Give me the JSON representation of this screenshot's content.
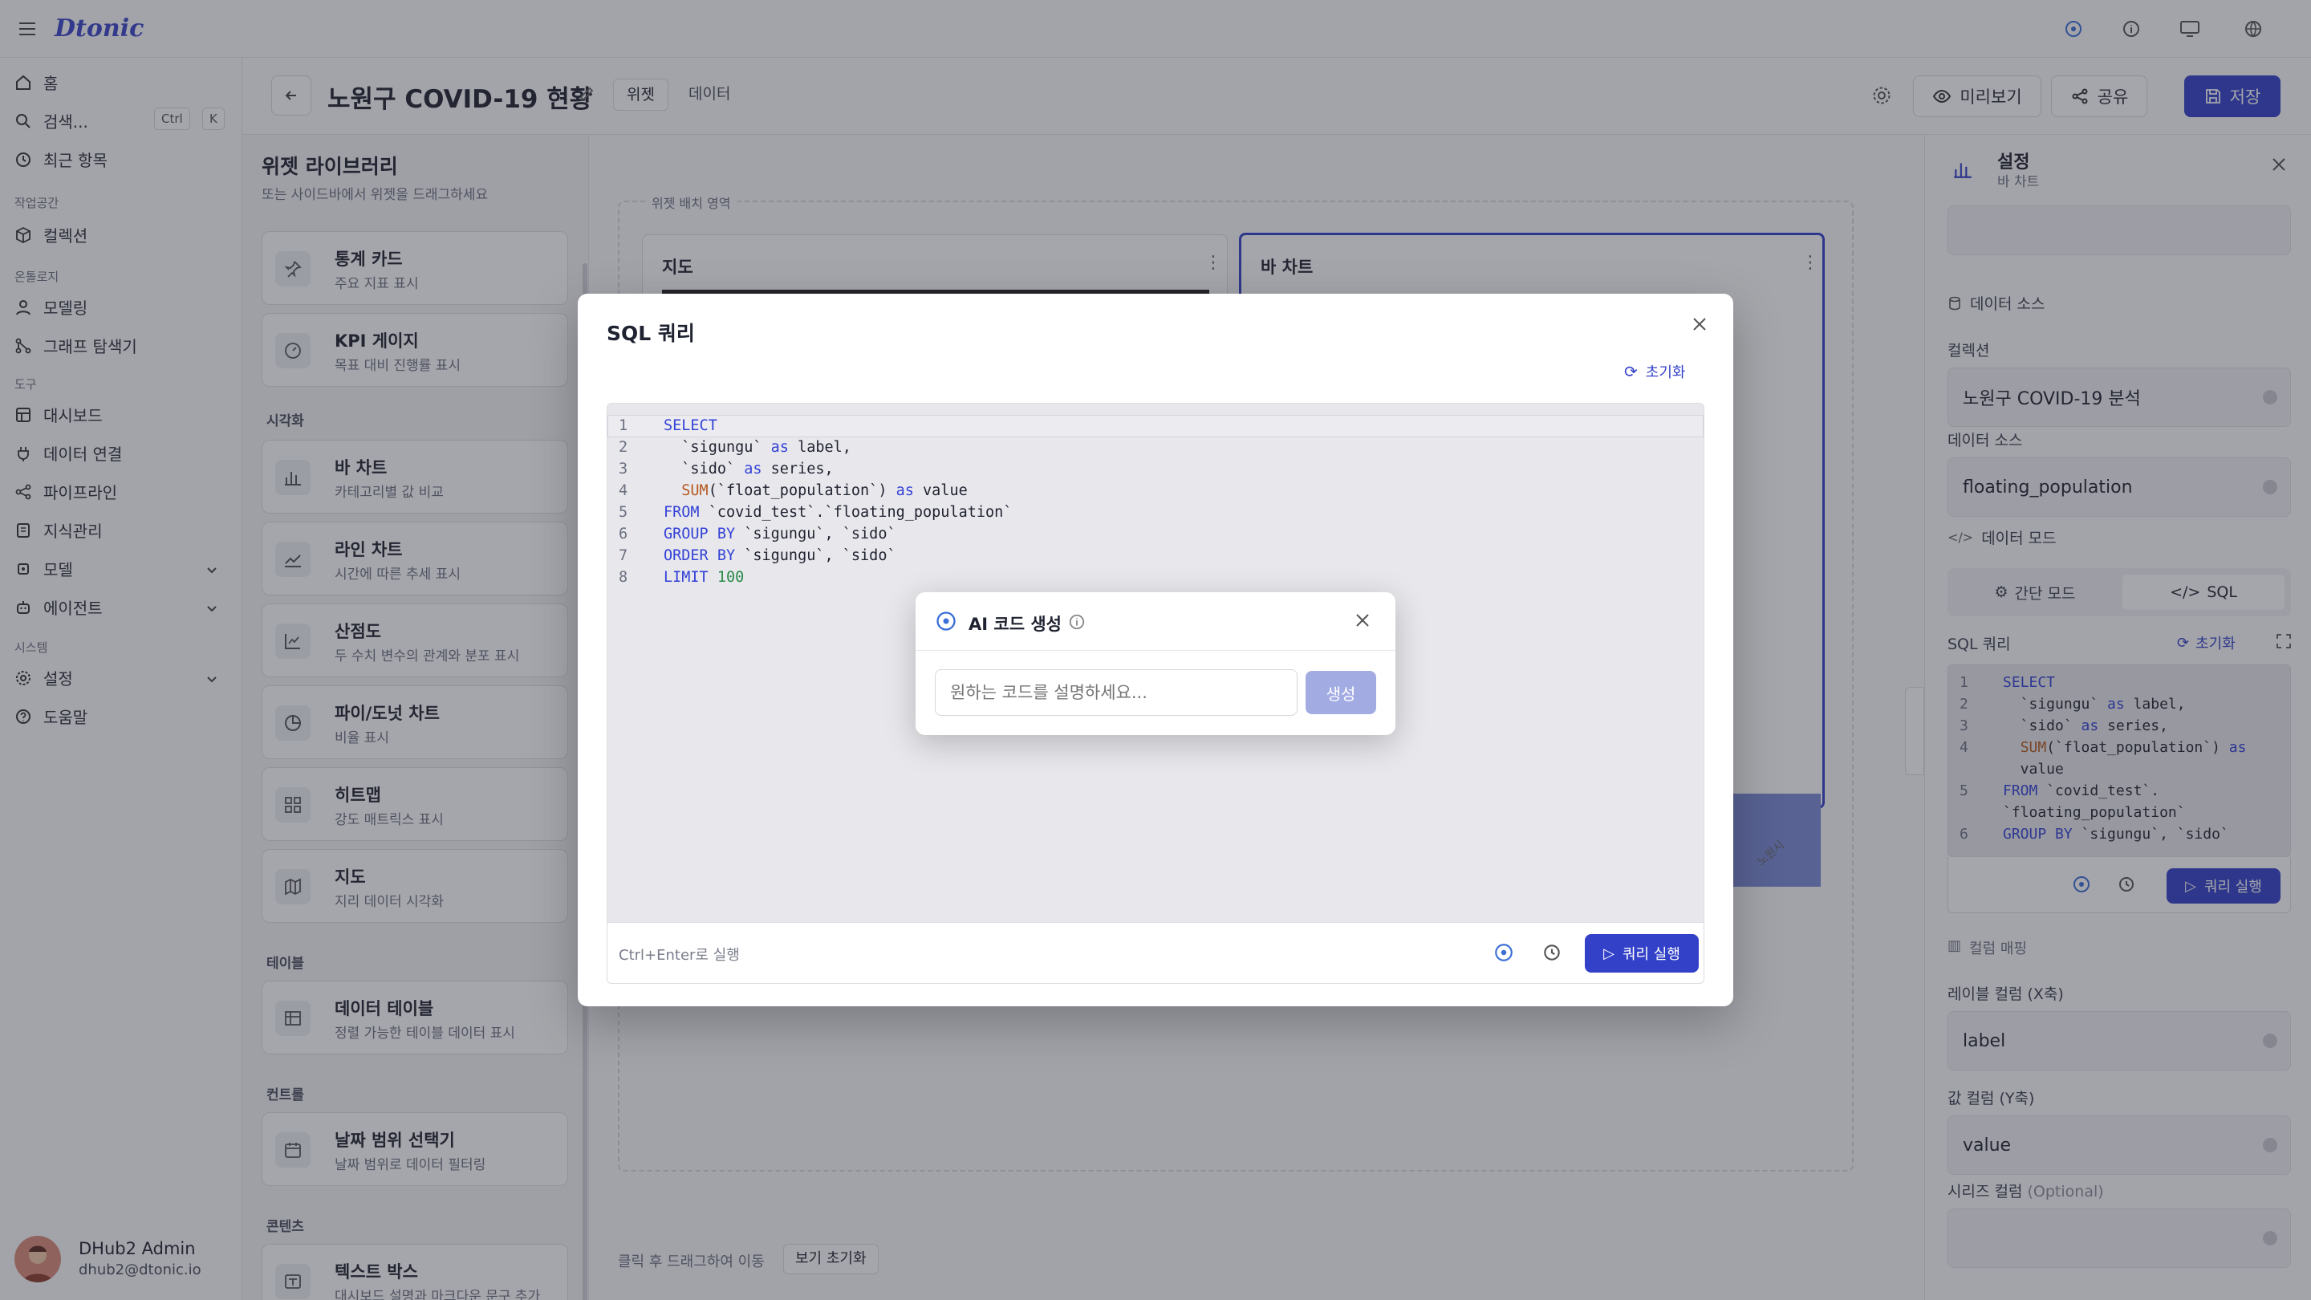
{
  "app": {
    "logo": "Dtonic"
  },
  "sidebar": {
    "items": [
      {
        "label": "홈"
      },
      {
        "label": "검색..."
      },
      {
        "label": "최근 항목"
      }
    ],
    "search_shortcut": [
      "Ctrl",
      "K"
    ],
    "sections": {
      "workspace": "작업공간",
      "ontology": "온톨로지",
      "tools": "도구",
      "system": "시스템"
    },
    "workspace_items": [
      {
        "label": "컬렉션"
      }
    ],
    "ontology_items": [
      {
        "label": "모델링"
      },
      {
        "label": "그래프 탐색기"
      }
    ],
    "tool_items": [
      {
        "label": "대시보드"
      },
      {
        "label": "데이터 연결"
      },
      {
        "label": "파이프라인"
      },
      {
        "label": "지식관리"
      },
      {
        "label": "모델"
      },
      {
        "label": "에이전트"
      }
    ],
    "system_items": [
      {
        "label": "설정"
      },
      {
        "label": "도움말"
      }
    ],
    "user": {
      "name": "DHub2 Admin",
      "email": "dhub2@dtonic.io"
    }
  },
  "header": {
    "title": "노원구 COVID-19 현황",
    "tabs": [
      {
        "label": "위젯"
      },
      {
        "label": "데이터"
      }
    ],
    "preview_label": "미리보기",
    "share_label": "공유",
    "save_label": "저장"
  },
  "library": {
    "title": "위젯 라이브러리",
    "subtitle": "또는 사이드바에서 위젯을 드래그하세요",
    "cards_top": [
      {
        "title": "통계 카드",
        "desc": "주요 지표 표시"
      },
      {
        "title": "KPI 게이지",
        "desc": "목표 대비 진행률 표시"
      }
    ],
    "sec_viz": "시각화",
    "viz": [
      {
        "title": "바 차트",
        "desc": "카테고리별 값 비교"
      },
      {
        "title": "라인 차트",
        "desc": "시간에 따른 추세 표시"
      },
      {
        "title": "산점도",
        "desc": "두 수치 변수의 관계와 분포 표시"
      },
      {
        "title": "파이/도넛 차트",
        "desc": "비율 표시"
      },
      {
        "title": "히트맵",
        "desc": "강도 매트릭스 표시"
      },
      {
        "title": "지도",
        "desc": "지리 데이터 시각화"
      }
    ],
    "sec_table": "테이블",
    "table": [
      {
        "title": "데이터 테이블",
        "desc": "정렬 가능한 테이블 데이터 표시"
      }
    ],
    "sec_control": "컨트롤",
    "control": [
      {
        "title": "날짜 범위 선택기",
        "desc": "날짜 범위로 데이터 필터링"
      }
    ],
    "sec_content": "콘텐츠",
    "content": [
      {
        "title": "텍스트 박스",
        "desc": "대시보드 설명과 마크다운 문구 추가"
      }
    ]
  },
  "canvas": {
    "area_label": "위젯 배치 영역",
    "widget_map": "지도",
    "widget_bar": "바 차트",
    "hint": "클릭 후 드래그하여 이동",
    "reset_view": "보기 초기화",
    "bar_tick": "노원시"
  },
  "right_panel": {
    "title": "설정",
    "subtitle": "바 차트",
    "datasource_heading": "데이터 소스",
    "collection_label": "컬렉션",
    "collection_value": "노원구 COVID-19 분석",
    "source_label": "데이터 소스",
    "source_value": "floating_population",
    "mode_heading": "데이터 모드",
    "mode_simple": "간단 모드",
    "mode_sql": "SQL",
    "sql_label": "SQL 쿼리",
    "reset": "초기화",
    "run": "쿼리 실행",
    "mini_code": [
      {
        "n": "1",
        "text": "SELECT"
      },
      {
        "n": "2",
        "text": "  `sigungu` as label,"
      },
      {
        "n": "3",
        "text": "  `sido` as series,"
      },
      {
        "n": "4",
        "text": "  SUM(`float_population`) as"
      },
      {
        "n": "",
        "text": "  value"
      },
      {
        "n": "5",
        "text": "FROM `covid_test`."
      },
      {
        "n": "",
        "text": "`floating_population`"
      },
      {
        "n": "6",
        "text": "GROUP BY `sigungu`, `sido`"
      }
    ],
    "column_mapping": "컬럼 매핑",
    "label_col": "레이블 컬럼 (X축)",
    "label_value": "label",
    "value_col": "값 컬럼 (Y축)",
    "value_value": "value",
    "series_col": "시리즈 컬럼",
    "series_optional": "(Optional)"
  },
  "modal": {
    "title": "SQL 쿼리",
    "reset": "초기화",
    "code": [
      {
        "n": "1",
        "text": "SELECT"
      },
      {
        "n": "2",
        "text": "  `sigungu` as label,"
      },
      {
        "n": "3",
        "text": "  `sido` as series,"
      },
      {
        "n": "4",
        "text": "  SUM(`float_population`) as value"
      },
      {
        "n": "5",
        "text": "FROM `covid_test`.`floating_population`"
      },
      {
        "n": "6",
        "text": "GROUP BY `sigungu`, `sido`"
      },
      {
        "n": "7",
        "text": "ORDER BY `sigungu`, `sido`"
      },
      {
        "n": "8",
        "text": "LIMIT 100"
      }
    ],
    "hint": "Ctrl+Enter로 실행",
    "run": "쿼리 실행"
  },
  "ai": {
    "title": "AI 코드 생성",
    "placeholder": "원하는 코드를 설명하세요...",
    "generate": "생성"
  }
}
